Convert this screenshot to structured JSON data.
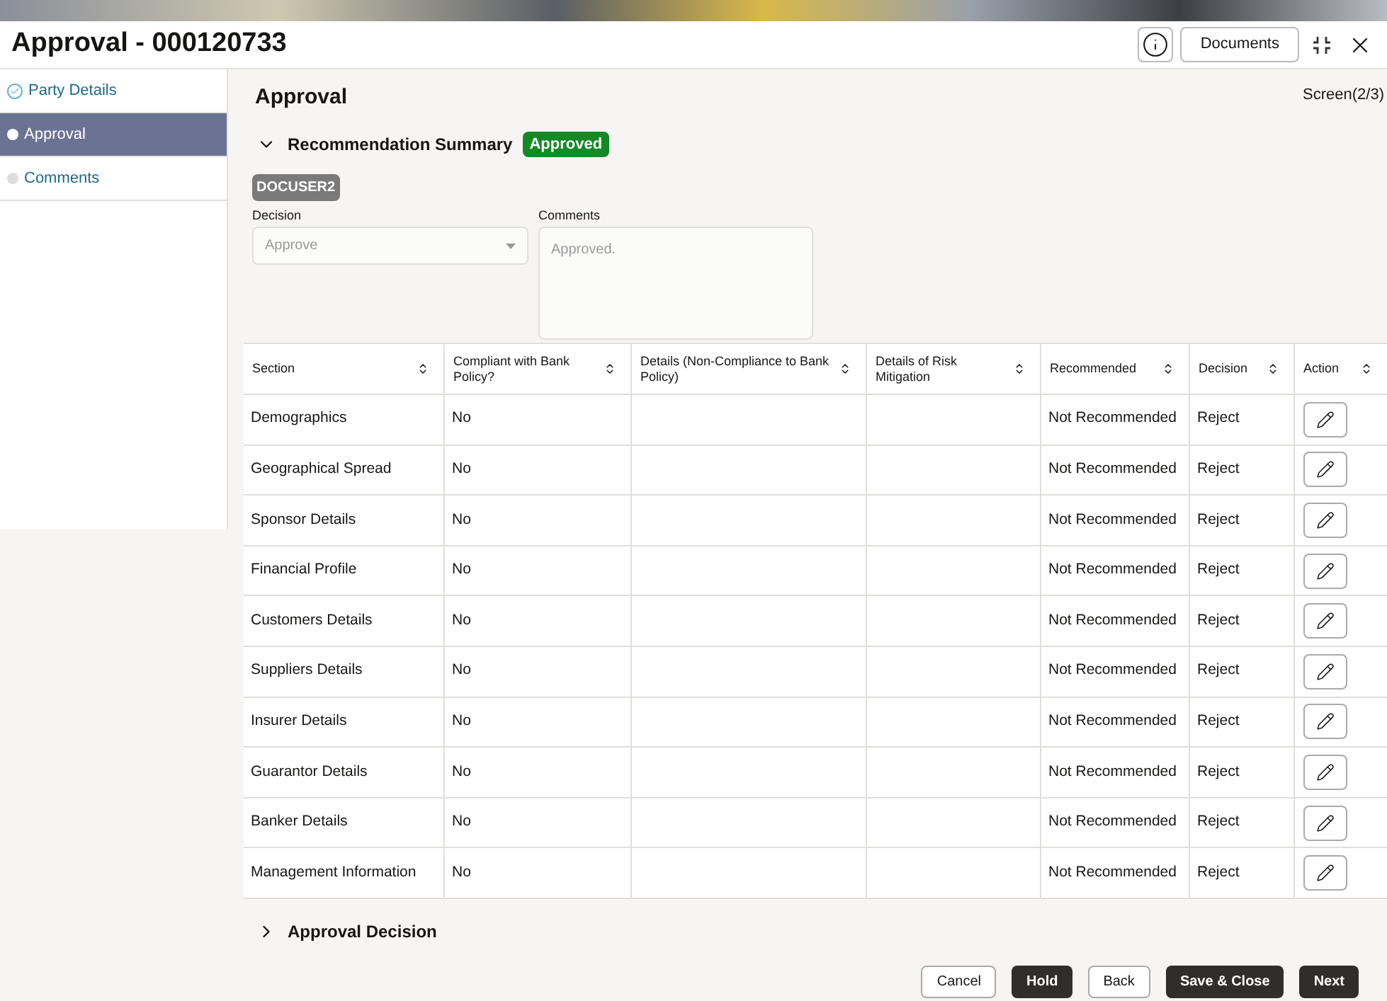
{
  "window": {
    "title": "Approval - 000120733",
    "documents_button": "Documents"
  },
  "steps": [
    {
      "label": "Party Details",
      "selected": false,
      "done": true
    },
    {
      "label": "Approval",
      "selected": true,
      "done": false
    },
    {
      "label": "Comments",
      "selected": false,
      "done": false
    }
  ],
  "page": {
    "heading": "Approval",
    "screen_indicator": "Screen(2/3)"
  },
  "recommendation_summary": {
    "title": "Recommendation Summary",
    "expanded": true,
    "status": "Approved",
    "user": "DOCUSER2",
    "decision": {
      "label": "Decision",
      "value": "Approve"
    },
    "comments": {
      "label": "Comments",
      "value": "Approved."
    }
  },
  "table": {
    "columns": [
      "Section",
      "Compliant with Bank Policy?",
      "Details (Non-Compliance to Bank Policy)",
      "Details of Risk Mitigation",
      "Recommended",
      "Decision",
      "Action"
    ],
    "rows": [
      {
        "section": "Demographics",
        "compliant": "No",
        "details": "",
        "mitigation": "",
        "recommended": "Not Recommended",
        "decision": "Reject"
      },
      {
        "section": "Geographical Spread",
        "compliant": "No",
        "details": "",
        "mitigation": "",
        "recommended": "Not Recommended",
        "decision": "Reject"
      },
      {
        "section": "Sponsor Details",
        "compliant": "No",
        "details": "",
        "mitigation": "",
        "recommended": "Not Recommended",
        "decision": "Reject"
      },
      {
        "section": "Financial Profile",
        "compliant": "No",
        "details": "",
        "mitigation": "",
        "recommended": "Not Recommended",
        "decision": "Reject"
      },
      {
        "section": "Customers Details",
        "compliant": "No",
        "details": "",
        "mitigation": "",
        "recommended": "Not Recommended",
        "decision": "Reject"
      },
      {
        "section": "Suppliers Details",
        "compliant": "No",
        "details": "",
        "mitigation": "",
        "recommended": "Not Recommended",
        "decision": "Reject"
      },
      {
        "section": "Insurer Details",
        "compliant": "No",
        "details": "",
        "mitigation": "",
        "recommended": "Not Recommended",
        "decision": "Reject"
      },
      {
        "section": "Guarantor Details",
        "compliant": "No",
        "details": "",
        "mitigation": "",
        "recommended": "Not Recommended",
        "decision": "Reject"
      },
      {
        "section": "Banker Details",
        "compliant": "No",
        "details": "",
        "mitigation": "",
        "recommended": "Not Recommended",
        "decision": "Reject"
      },
      {
        "section": "Management Information",
        "compliant": "No",
        "details": "",
        "mitigation": "",
        "recommended": "Not Recommended",
        "decision": "Reject"
      }
    ]
  },
  "approval_decision": {
    "title": "Approval Decision",
    "expanded": false
  },
  "footer_buttons": [
    {
      "label": "Cancel",
      "kind": "secondary"
    },
    {
      "label": "Hold",
      "kind": "primary"
    },
    {
      "label": "Back",
      "kind": "secondary"
    },
    {
      "label": "Save & Close",
      "kind": "primary"
    },
    {
      "label": "Next",
      "kind": "primary"
    }
  ]
}
